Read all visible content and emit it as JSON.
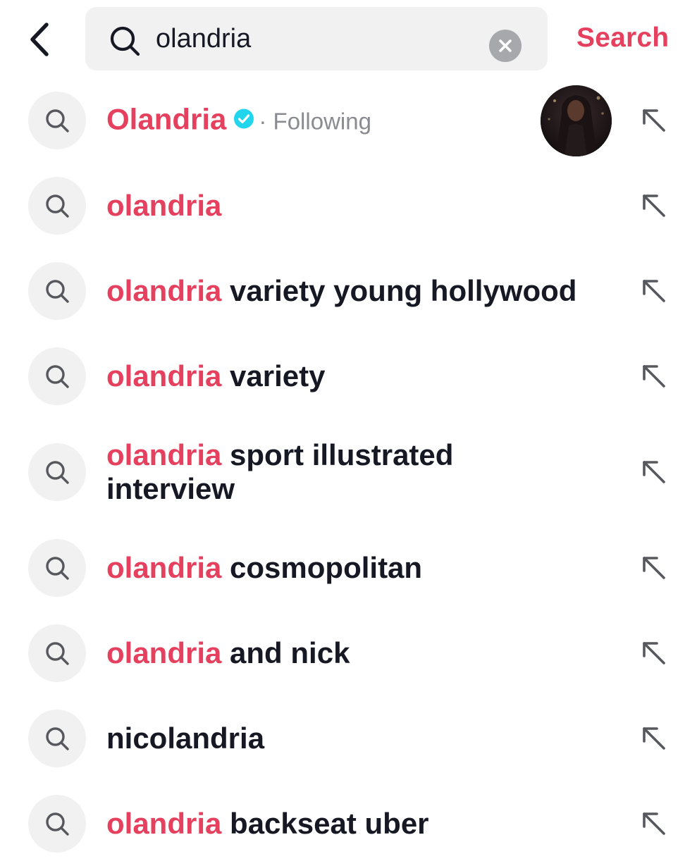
{
  "header": {
    "back_icon": "chevron-left-icon",
    "search_icon": "search-icon",
    "query": "olandria",
    "clear_icon": "clear-x-icon",
    "search_label": "Search"
  },
  "colors": {
    "accent": "#e6405f",
    "text": "#161823",
    "muted": "#8a8b91",
    "field_bg": "#f1f1f2",
    "verified": "#20d5ec"
  },
  "user_suggestion": {
    "name": "Olandria",
    "verified_icon": "verified-badge-icon",
    "relation": "· Following",
    "avatar_icon": "profile-photo"
  },
  "suggestions": [
    {
      "highlight": "olandria",
      "rest": ""
    },
    {
      "highlight": "olandria",
      "rest": " variety young hollywood"
    },
    {
      "highlight": "olandria",
      "rest": " variety"
    },
    {
      "highlight": "olandria",
      "rest": " sport illustrated interview"
    },
    {
      "highlight": "olandria",
      "rest": " cosmopolitan"
    },
    {
      "highlight": "olandria",
      "rest": " and nick"
    },
    {
      "highlight": "",
      "rest": "nicolandria"
    },
    {
      "highlight": "olandria",
      "rest": " backseat uber"
    }
  ],
  "row_icons": {
    "search": "search-icon",
    "fill": "arrow-up-left-icon"
  }
}
